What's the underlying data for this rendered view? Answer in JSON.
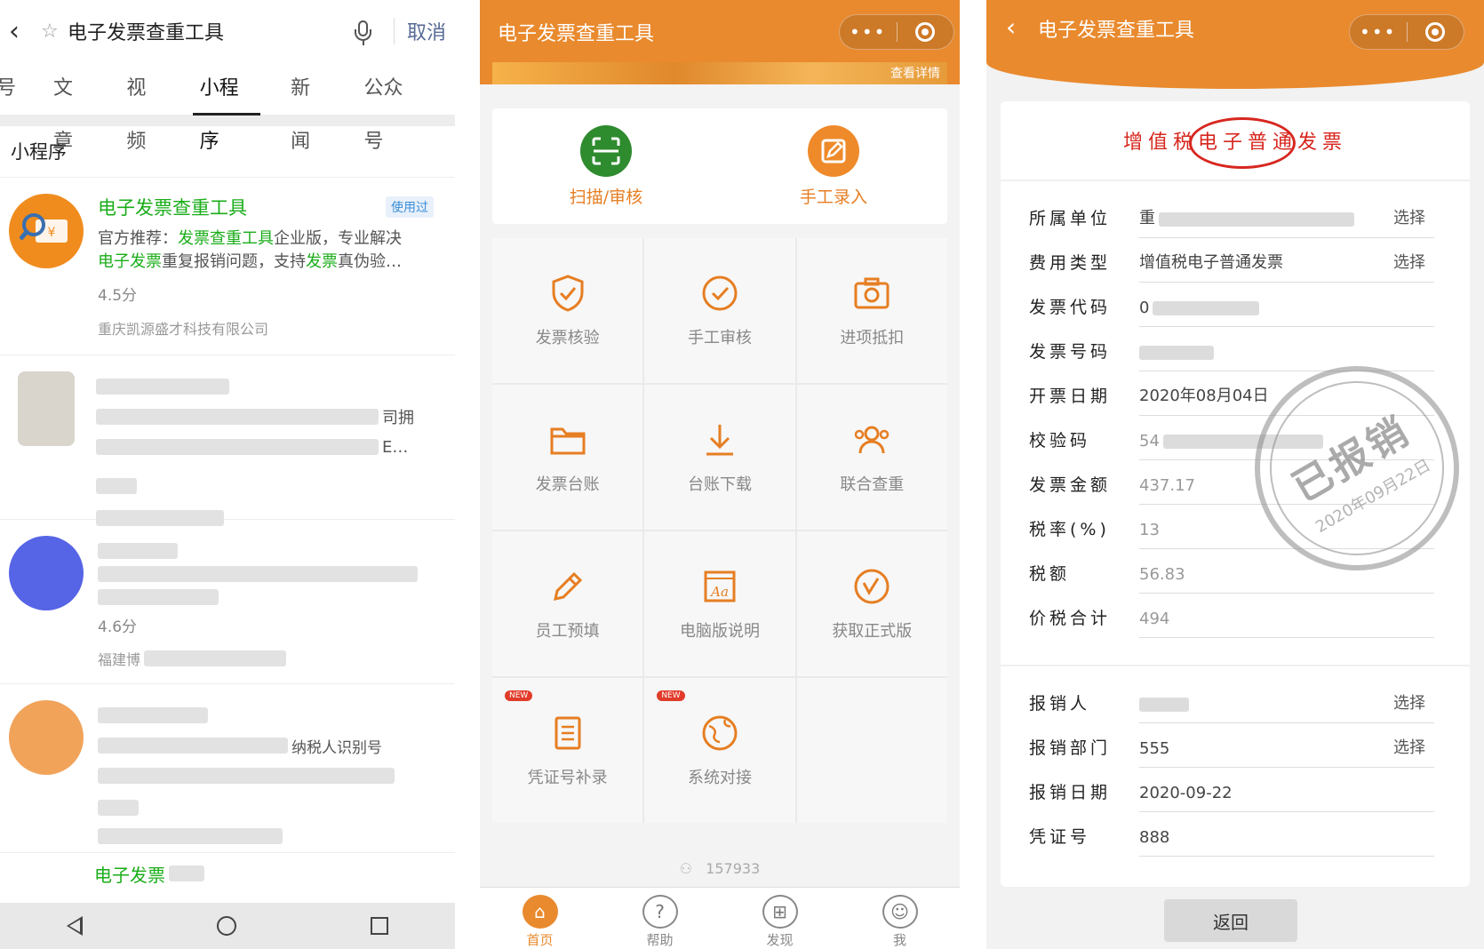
{
  "panel1": {
    "search_query": "电子发票查重工具",
    "cancel_label": "取消",
    "tabs": [
      "号",
      "文章",
      "视频",
      "小程序",
      "新闻",
      "公众号"
    ],
    "active_tab": "小程序",
    "section_title": "小程序",
    "result": {
      "name": "电子发票查重工具",
      "used_badge": "使用过",
      "desc_1": "官方推荐：",
      "desc_hl_1": "发票查重工具",
      "desc_2": "企业版，专业解决",
      "desc_hl_2": "电子发票",
      "desc_3": "重复报销问题，支持",
      "desc_hl_3": "发票",
      "desc_4": "真伪验…",
      "score": "4.5分",
      "company": "重庆凯源盛才科技有限公司"
    },
    "blurred_items": [
      {
        "tail_1": "司拥",
        "tail_2": "E…"
      },
      {
        "score": "4.6分",
        "company_prefix": "福建博"
      },
      {
        "text_1": "纳税人识别号"
      },
      {
        "name_prefix": "电子发票"
      }
    ]
  },
  "panel2": {
    "title": "电子发票查重工具",
    "banner_link": "查看详情",
    "quick": [
      {
        "label": "扫描/审核",
        "icon": "scan-icon"
      },
      {
        "label": "手工录入",
        "icon": "edit-icon"
      }
    ],
    "grid": [
      {
        "label": "发票核验",
        "icon": "shield-check-icon"
      },
      {
        "label": "手工审核",
        "icon": "check-circle-icon"
      },
      {
        "label": "进项抵扣",
        "icon": "camera-icon"
      },
      {
        "label": "发票台账",
        "icon": "folder-icon"
      },
      {
        "label": "台账下载",
        "icon": "download-icon"
      },
      {
        "label": "联合查重",
        "icon": "users-icon"
      },
      {
        "label": "员工预填",
        "icon": "pencil-icon"
      },
      {
        "label": "电脑版说明",
        "icon": "font-icon"
      },
      {
        "label": "获取正式版",
        "icon": "version-icon"
      },
      {
        "label": "凭证号补录",
        "icon": "document-icon",
        "badge": "NEW"
      },
      {
        "label": "系统对接",
        "icon": "globe-icon",
        "badge": "NEW"
      }
    ],
    "visitor_count": "157933",
    "tabbar": [
      {
        "label": "首页",
        "icon": "home-icon"
      },
      {
        "label": "帮助",
        "icon": "help-icon"
      },
      {
        "label": "发现",
        "icon": "gift-icon"
      },
      {
        "label": "我",
        "icon": "user-icon"
      }
    ]
  },
  "panel3": {
    "title": "电子发票查重工具",
    "invoice_title": "增值税电子普通发票",
    "fields": [
      {
        "label": "所属单位",
        "value": "重",
        "select": "选择"
      },
      {
        "label": "费用类型",
        "value": "增值税电子普通发票",
        "select": "选择"
      },
      {
        "label": "发票代码",
        "value": "0"
      },
      {
        "label": "发票号码",
        "value": ""
      },
      {
        "label": "开票日期",
        "value": "2020年08月04日"
      },
      {
        "label": "校验码",
        "value": "54"
      },
      {
        "label": "发票金额",
        "value": "437.17"
      },
      {
        "label": "税率(%)",
        "value": "13"
      },
      {
        "label": "税额",
        "value": "56.83"
      },
      {
        "label": "价税合计",
        "value": "494"
      }
    ],
    "fields2": [
      {
        "label": "报销人",
        "value": "",
        "select": "选择"
      },
      {
        "label": "报销部门",
        "value": "555",
        "select": "选择"
      },
      {
        "label": "报销日期",
        "value": "2020-09-22"
      },
      {
        "label": "凭证号",
        "value": "888"
      }
    ],
    "stamp_main": "已报销",
    "stamp_date": "2020年09月22日",
    "back_button": "返回"
  },
  "colors": {
    "accent": "#e98a2e",
    "green": "#1aad19",
    "red": "#d7271f"
  }
}
